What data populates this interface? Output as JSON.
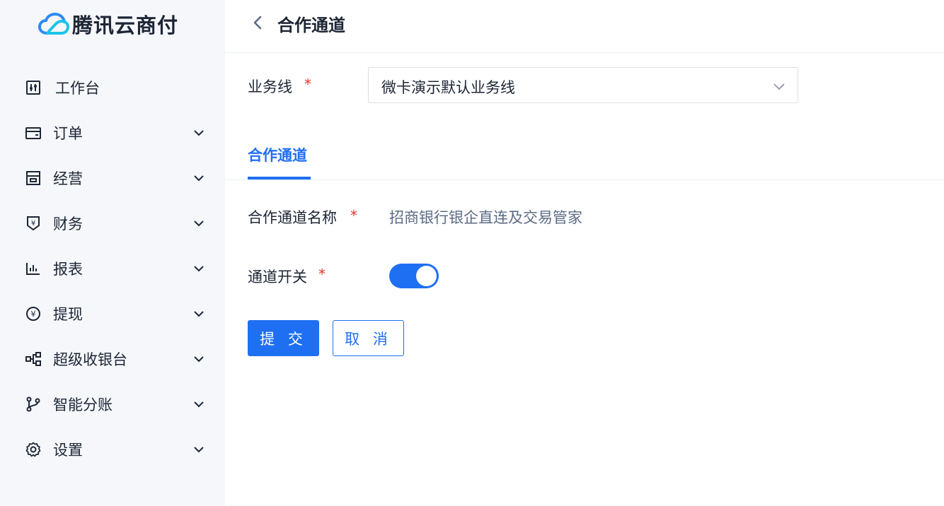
{
  "brand": {
    "name": "腾讯云商付",
    "logo_icon": "cloud-logo-icon",
    "color": "#1f6ff2"
  },
  "sidebar": {
    "items": [
      {
        "label": "工作台",
        "icon": "dashboard-icon",
        "expandable": false
      },
      {
        "label": "订单",
        "icon": "wallet-card-icon",
        "expandable": true
      },
      {
        "label": "经营",
        "icon": "store-icon",
        "expandable": true
      },
      {
        "label": "财务",
        "icon": "yuan-shield-icon",
        "expandable": true
      },
      {
        "label": "报表",
        "icon": "bar-chart-icon",
        "expandable": true
      },
      {
        "label": "提现",
        "icon": "yuan-circle-icon",
        "expandable": true
      },
      {
        "label": "超级收银台",
        "icon": "node-graph-icon",
        "expandable": true
      },
      {
        "label": "智能分账",
        "icon": "git-branch-icon",
        "expandable": true
      },
      {
        "label": "设置",
        "icon": "gear-icon",
        "expandable": true
      }
    ]
  },
  "header": {
    "title": "合作通道",
    "back_icon": "chevron-left-icon"
  },
  "form": {
    "business_line": {
      "label": "业务线",
      "required_mark": "*",
      "value": "微卡演示默认业务线"
    },
    "tab": {
      "label": "合作通道"
    },
    "channel_name": {
      "label": "合作通道名称",
      "required_mark": "*",
      "value": "招商银行银企直连及交易管家"
    },
    "channel_switch": {
      "label": "通道开关",
      "required_mark": "*",
      "on": true
    },
    "submit_label": "提 交",
    "cancel_label": "取 消"
  },
  "colors": {
    "accent": "#1f6ff2",
    "required": "#e5352e",
    "sidebar_bg": "#f5f7fb"
  }
}
